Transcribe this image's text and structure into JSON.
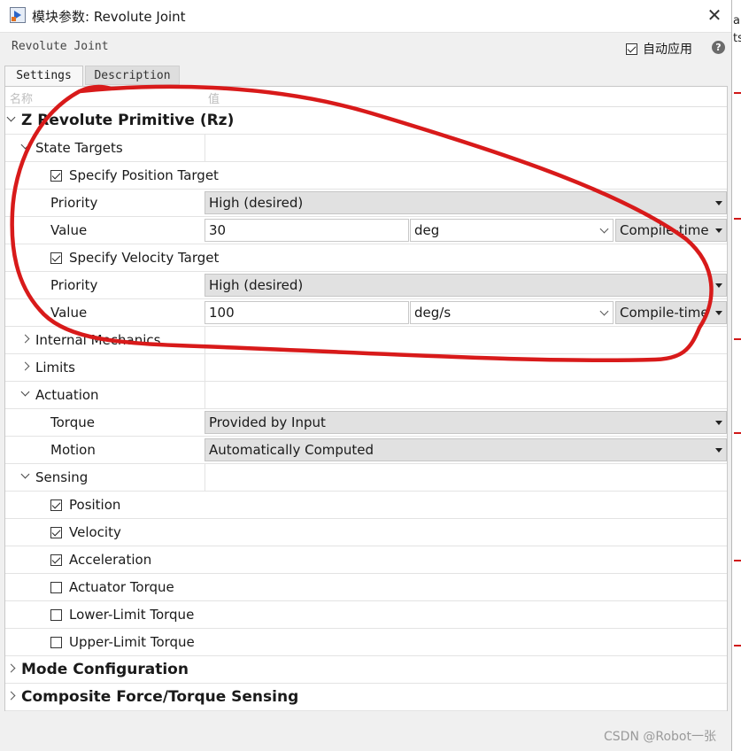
{
  "window": {
    "title": "模块参数: Revolute Joint",
    "block_name": "Revolute Joint",
    "auto_apply_label": "自动应用",
    "auto_apply_checked": true,
    "close_glyph": "✕",
    "help_glyph": "?"
  },
  "right_strip": {
    "line1": "ap",
    "line2": "ts"
  },
  "tabs": {
    "settings": "Settings",
    "description": "Description"
  },
  "columns": {
    "name": "名称",
    "value": "值"
  },
  "sections": {
    "primitive": "Z Revolute Primitive (Rz)",
    "state_targets": "State Targets",
    "specify_position_target": "Specify Position Target",
    "position_priority_label": "Priority",
    "position_priority_value": "High (desired)",
    "position_value_label": "Value",
    "position_value": "30",
    "position_unit": "deg",
    "position_eval": "Compile-time",
    "specify_velocity_target": "Specify Velocity Target",
    "velocity_priority_label": "Priority",
    "velocity_priority_value": "High (desired)",
    "velocity_value_label": "Value",
    "velocity_value": "100",
    "velocity_unit": "deg/s",
    "velocity_eval": "Compile-time",
    "internal_mechanics": "Internal Mechanics",
    "limits": "Limits",
    "actuation": "Actuation",
    "torque_label": "Torque",
    "torque_value": "Provided by Input",
    "motion_label": "Motion",
    "motion_value": "Automatically Computed",
    "sensing": "Sensing",
    "sense_position": "Position",
    "sense_velocity": "Velocity",
    "sense_acceleration": "Acceleration",
    "sense_actuator_torque": "Actuator Torque",
    "sense_lower_limit": "Lower-Limit Torque",
    "sense_upper_limit": "Upper-Limit Torque",
    "mode_configuration": "Mode Configuration",
    "composite_force": "Composite Force/Torque Sensing"
  },
  "checkbox_states": {
    "specify_position_target": true,
    "specify_velocity_target": true,
    "sense_position": true,
    "sense_velocity": true,
    "sense_acceleration": true,
    "sense_actuator_torque": false,
    "sense_lower_limit": false,
    "sense_upper_limit": false
  },
  "annotation": {
    "color": "#d81a1a"
  },
  "watermark": "CSDN @Robot一张"
}
